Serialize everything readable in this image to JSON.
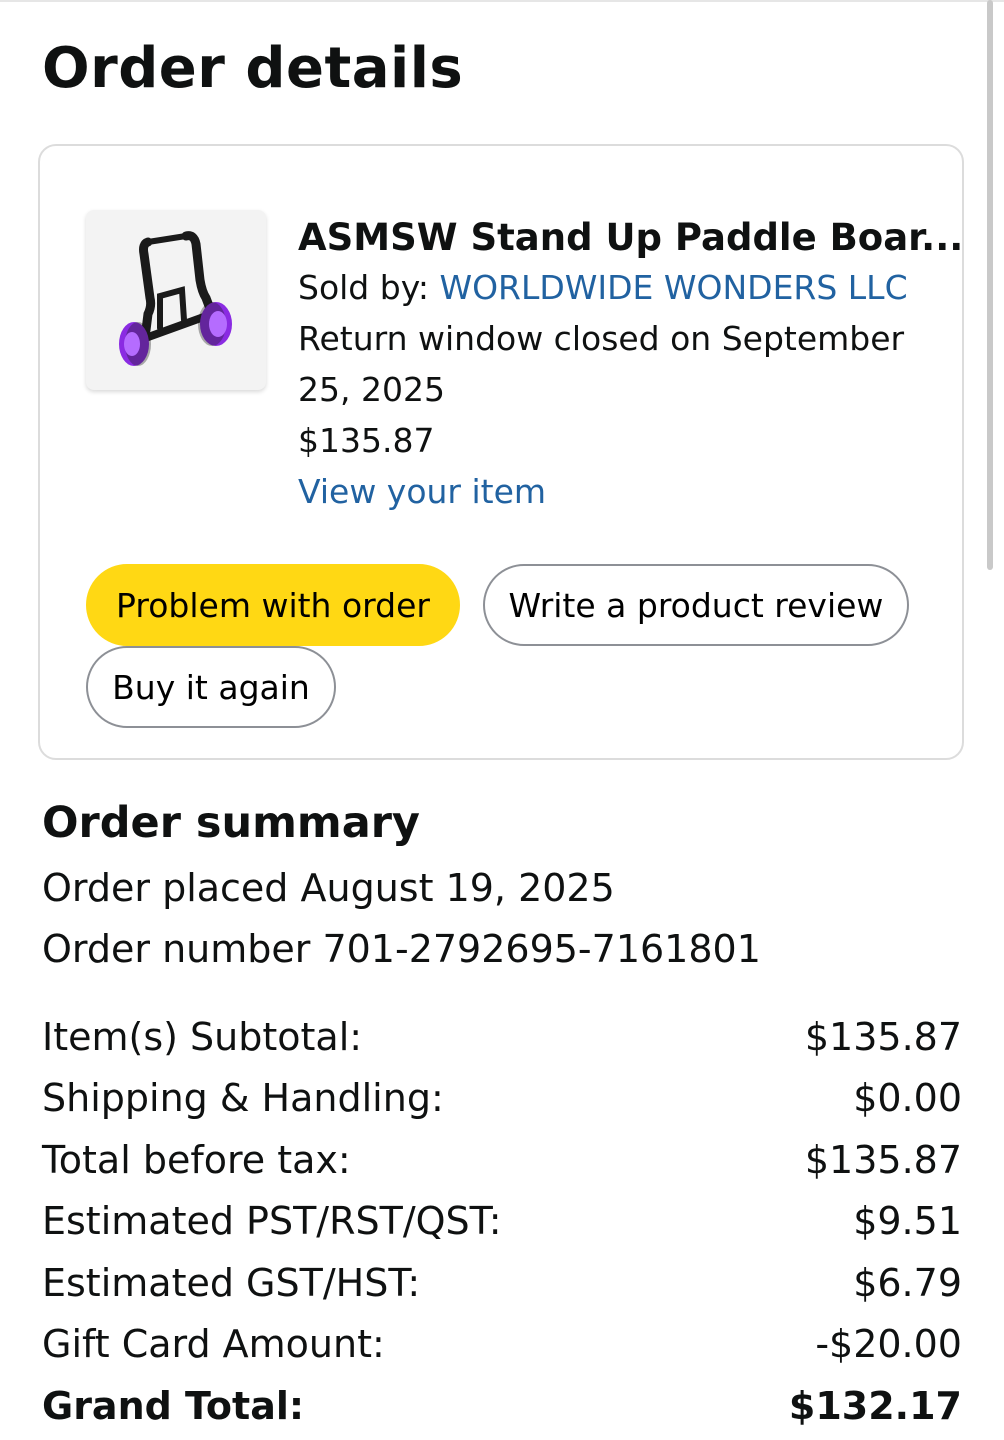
{
  "page": {
    "title": "Order details"
  },
  "item": {
    "title": "ASMSW Stand Up Paddle Boar...",
    "sold_by_label": "Sold by:",
    "seller": "WORLDWIDE WONDERS LLC",
    "return_window": "Return window closed on September 25, 2025",
    "price": "$135.87",
    "view_link": "View your item",
    "image_icon": "paddle-board-cart-image",
    "wheel_color": "#8a2be2"
  },
  "actions": {
    "problem": "Problem with order",
    "review": "Write a product review",
    "buy_again": "Buy it again",
    "primary_color": "#ffd814"
  },
  "summary": {
    "title": "Order summary",
    "placed": "Order placed August 19, 2025",
    "number": "Order number 701-2792695-7161801",
    "rows": [
      {
        "label": "Item(s) Subtotal:",
        "value": "$135.87"
      },
      {
        "label": "Shipping & Handling:",
        "value": "$0.00"
      },
      {
        "label": "Total before tax:",
        "value": "$135.87"
      },
      {
        "label": "Estimated PST/RST/QST:",
        "value": "$9.51"
      },
      {
        "label": "Estimated GST/HST:",
        "value": "$6.79"
      },
      {
        "label": "Gift Card Amount:",
        "value": "-$20.00"
      },
      {
        "label": "Grand Total:",
        "value": "$132.17"
      }
    ]
  },
  "link_color": "#2162a1"
}
